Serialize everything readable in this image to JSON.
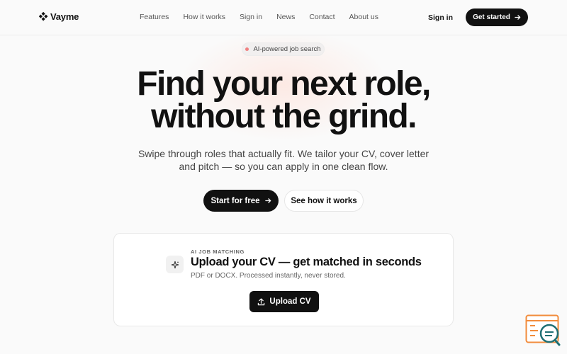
{
  "brand": {
    "name": "Vayme"
  },
  "nav": {
    "links": [
      "Features",
      "How it works",
      "Sign in",
      "News",
      "Contact",
      "About us"
    ],
    "signin_label": "Sign in",
    "cta_label": "Get started"
  },
  "hero": {
    "badge": "AI-powered job search",
    "headline_line1": "Find your next role,",
    "headline_line2": "without the grind.",
    "subtitle": "Swipe through roles that actually fit. We tailor your CV, cover letter and pitch — so you can apply in one clean flow.",
    "primary_label": "Start for free",
    "secondary_label": "See how it works"
  },
  "upload_card": {
    "eyebrow": "AI JOB MATCHING",
    "title": "Upload your CV — get matched in seconds",
    "description": "PDF or DOCX. Processed instantly, never stored.",
    "button_label": "Upload CV"
  },
  "colors": {
    "primary": "#111111",
    "background": "#fafafa",
    "badge_dot": "#f08080",
    "widget_orange": "#f28c3c",
    "widget_teal": "#1f6f73"
  },
  "icons": {
    "logo": "diamond-cluster-icon",
    "arrow": "arrow-right-icon",
    "sparkle": "sparkle-icon",
    "upload": "upload-icon",
    "chat": "chat-search-icon"
  }
}
